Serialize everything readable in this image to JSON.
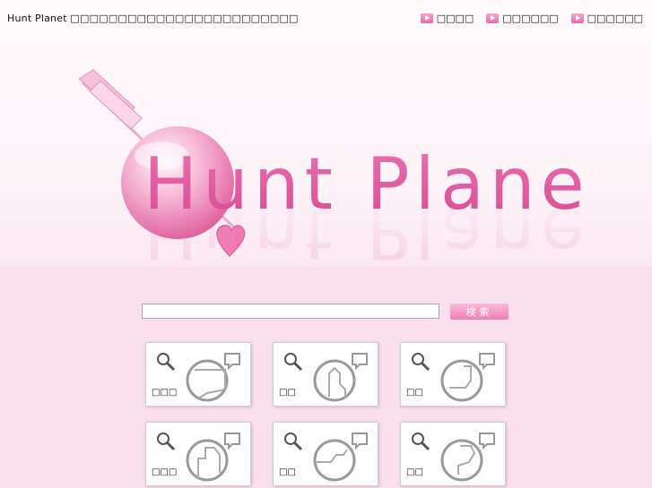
{
  "header": {
    "site_title": "Hunt Planet □□□□□□□□□□□□□□□□□□□□□□□□"
  },
  "nav": {
    "items": [
      {
        "label": "□□□□"
      },
      {
        "label": "□□□□□□"
      },
      {
        "label": "□□□□□□"
      }
    ]
  },
  "logo": {
    "text": "Hunt Planet"
  },
  "search": {
    "value": "",
    "placeholder": "",
    "button_label": "検索"
  },
  "tiles": [
    {
      "label": "□□□"
    },
    {
      "label": "□□"
    },
    {
      "label": "□□"
    },
    {
      "label": "□□□"
    },
    {
      "label": "□□"
    },
    {
      "label": "□□"
    }
  ],
  "colors": {
    "accent": "#e25fa3",
    "background_top": "#fefafc",
    "background_bottom": "#f9e0ec",
    "tile_border": "#d7c9cf"
  },
  "icons": [
    "play-arrow-icon",
    "magnifier-icon",
    "speech-bubble-icon",
    "region-map-icon",
    "arrow-icon",
    "heart-icon"
  ]
}
